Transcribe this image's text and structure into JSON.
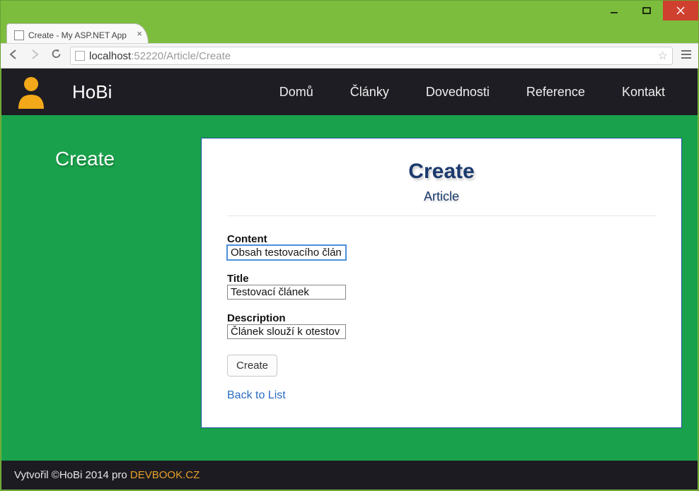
{
  "window": {
    "tab_title": "Create - My ASP.NET App",
    "url_host": "localhost",
    "url_port_path": ":52220/Article/Create"
  },
  "header": {
    "brand": "HoBi",
    "nav": [
      "Domů",
      "Články",
      "Dovednosti",
      "Reference",
      "Kontakt"
    ]
  },
  "sidebar": {
    "title": "Create"
  },
  "card": {
    "heading": "Create",
    "subtitle": "Article",
    "fields": {
      "content_label": "Content",
      "content_value": "Obsah testovacího člán",
      "title_label": "Title",
      "title_value": "Testovací článek",
      "description_label": "Description",
      "description_value": "Článek slouží k otestov"
    },
    "submit_label": "Create",
    "back_link": "Back to List"
  },
  "footer": {
    "text_prefix": "Vytvořil ©HoBi 2014 pro ",
    "link": "DEVBOOK.CZ"
  }
}
